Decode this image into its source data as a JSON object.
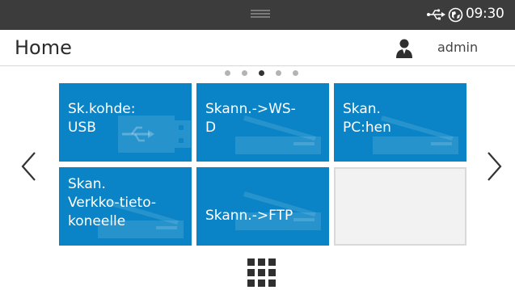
{
  "status_bar": {
    "time": "09:30",
    "icons": [
      "handle-icon",
      "usb-icon",
      "globe-icon"
    ]
  },
  "header": {
    "title": "Home",
    "user_icon": "user-icon",
    "username": "admin"
  },
  "pager": {
    "page_count": 5,
    "current_page": 3
  },
  "tiles": [
    {
      "label": "Sk.kohde:\nUSB",
      "icon": "usb-drive-icon"
    },
    {
      "label": "Skann.->WS-\nD",
      "icon": "scanner-icon"
    },
    {
      "label": "Skan.\nPC:hen",
      "icon": "scanner-icon"
    },
    {
      "label": "Skan.\nVerkko-tieto-\nkoneelle",
      "icon": "scanner-icon"
    },
    {
      "label": "Skann.->FTP",
      "icon": "scanner-icon"
    },
    {
      "label": "",
      "icon": ""
    }
  ],
  "navigation": {
    "prev_icon": "chevron-left-icon",
    "next_icon": "chevron-right-icon",
    "apps_icon": "apps-grid-icon"
  },
  "colors": {
    "status_bar": "#3c3c3c",
    "tile": "#0a84c6",
    "tile_text": "#ffffff",
    "empty_tile": "#f2f2f2"
  }
}
